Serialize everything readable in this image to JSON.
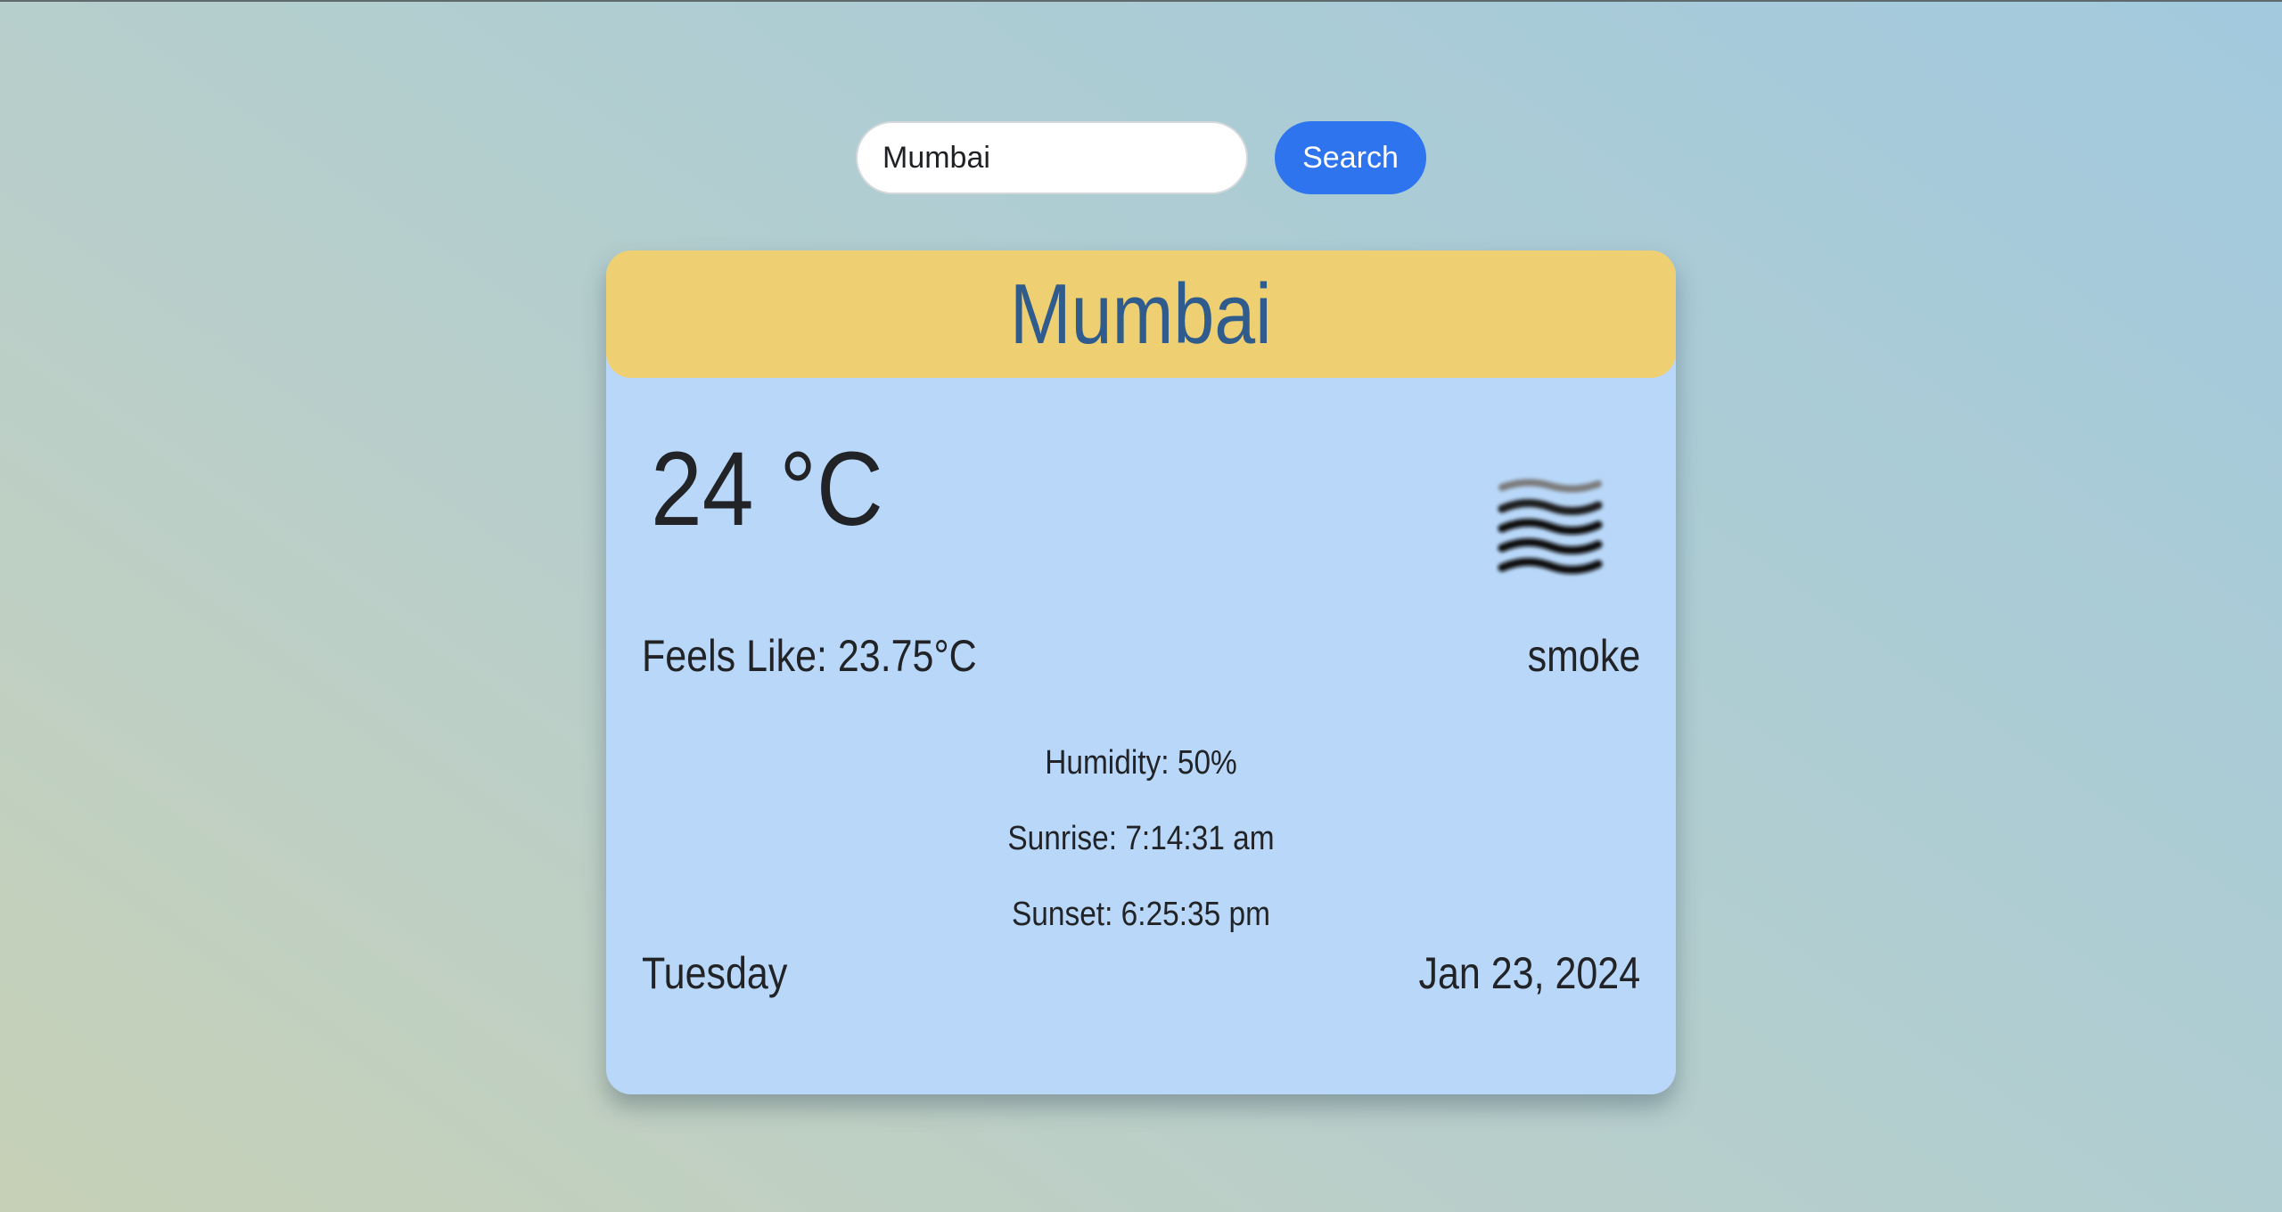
{
  "search": {
    "value": "Mumbai",
    "button_label": "Search"
  },
  "weather": {
    "city": "Mumbai",
    "temperature": "24 °C",
    "feels_like": "Feels Like: 23.75°C",
    "condition": "smoke",
    "condition_icon": "haze-icon",
    "humidity": "Humidity: 50%",
    "sunrise": "Sunrise: 7:14:31 am",
    "sunset": "Sunset: 6:25:35 pm",
    "day": "Tuesday",
    "date": "Jan 23, 2024"
  },
  "colors": {
    "header_bg": "#eecf71",
    "card_bg": "#b9d8f9",
    "city_text": "#2f5c8c",
    "button_bg": "#2d74ee"
  }
}
